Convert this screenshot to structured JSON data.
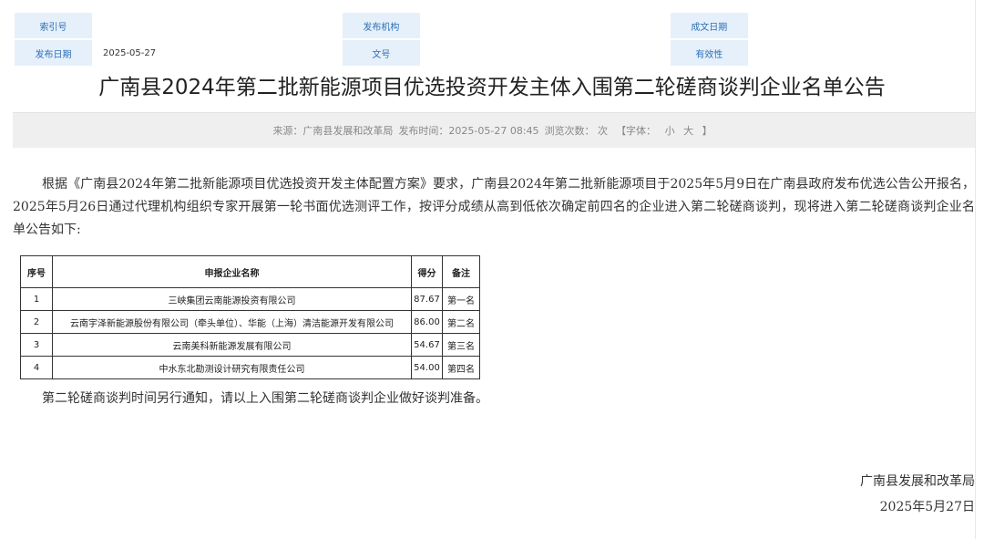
{
  "meta": {
    "index_label": "索引号",
    "index_value": "",
    "org_label": "发布机构",
    "org_value": "",
    "date_written_label": "成文日期",
    "date_written_value": "",
    "pub_date_label": "发布日期",
    "pub_date_value": "2025-05-27",
    "doc_no_label": "文号",
    "doc_no_value": "",
    "validity_label": "有效性",
    "validity_value": ""
  },
  "title": "广南县2024年第二批新能源项目优选投资开发主体入围第二轮磋商谈判企业名单公告",
  "info": {
    "source": "来源：广南县发展和改革局",
    "publish_time": "发布时间：2025-05-27 08:45",
    "views": "浏览次数：  次",
    "font_prefix": "【字体：",
    "font_small": "小",
    "font_large": "大",
    "font_suffix": "】"
  },
  "body": {
    "paragraph": "根据《广南县2024年第二批新能源项目优选投资开发主体配置方案》要求，广南县2024年第二批新能源项目于2025年5月9日在广南县政府发布优选公告公开报名，2025年5月26日通过代理机构组织专家开展第一轮书面优选测评工作，按评分成绩从高到低依次确定前四名的企业进入第二轮磋商谈判，现将进入第二轮磋商谈判企业名单公告如下:"
  },
  "table": {
    "headers": [
      "序号",
      "申报企业名称",
      "得分",
      "备注"
    ],
    "rows": [
      [
        "1",
        "三峡集团云南能源投资有限公司",
        "87.67",
        "第一名"
      ],
      [
        "2",
        "云南宇泽新能源股份有限公司（牵头单位）、华能（上海）清洁能源开发有限公司",
        "86.00",
        "第二名"
      ],
      [
        "3",
        "云南美科新能源发展有限公司",
        "54.67",
        "第三名"
      ],
      [
        "4",
        "中水东北勘测设计研究有限责任公司",
        "54.00",
        "第四名"
      ]
    ]
  },
  "closing": "第二轮磋商谈判时间另行通知，请以上入围第二轮磋商谈判企业做好谈判准备。",
  "signature": {
    "org": "广南县发展和改革局",
    "date": "2025年5月27日"
  }
}
